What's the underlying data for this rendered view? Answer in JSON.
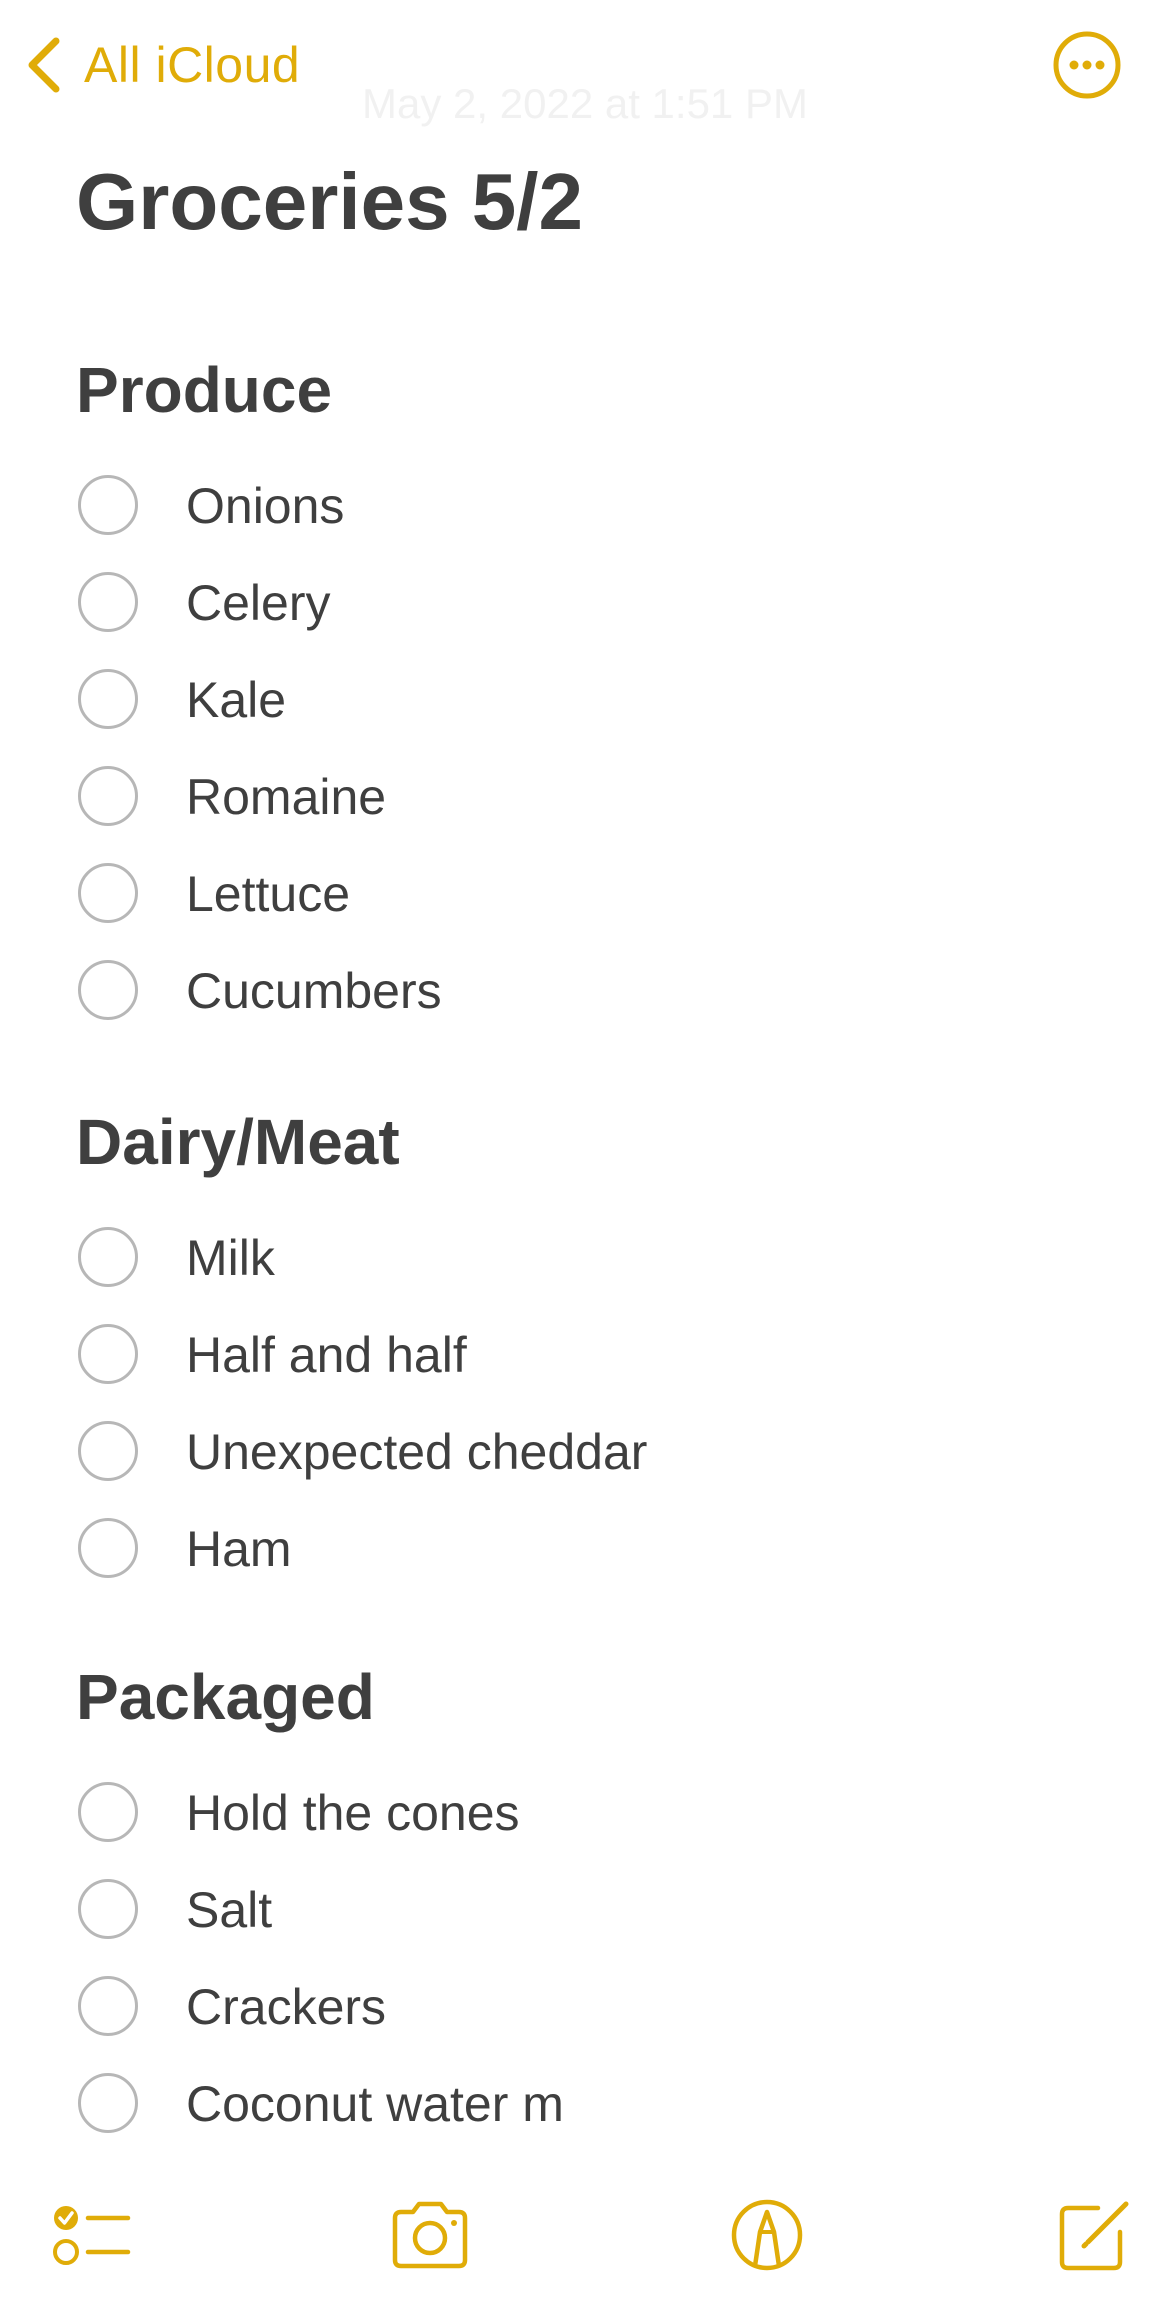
{
  "colors": {
    "accent": "#e0ac08",
    "text": "#3f3f3f",
    "checkbox_border": "#b7b7b7",
    "timestamp": "#f1f1f1"
  },
  "nav": {
    "back_label": "All iCloud",
    "back_icon": "chevron-left-icon",
    "timestamp": "May 2, 2022 at 1:51 PM",
    "more_icon": "ellipsis-circle-icon"
  },
  "note": {
    "title": "Groceries 5/2",
    "sections": [
      {
        "heading": "Produce",
        "items": [
          {
            "label": "Onions",
            "checked": false
          },
          {
            "label": "Celery",
            "checked": false
          },
          {
            "label": "Kale",
            "checked": false
          },
          {
            "label": "Romaine",
            "checked": false
          },
          {
            "label": "Lettuce",
            "checked": false
          },
          {
            "label": "Cucumbers",
            "checked": false
          }
        ]
      },
      {
        "heading": "Dairy/Meat",
        "items": [
          {
            "label": "Milk",
            "checked": false
          },
          {
            "label": "Half and half",
            "checked": false
          },
          {
            "label": "Unexpected cheddar",
            "checked": false
          },
          {
            "label": "Ham",
            "checked": false
          }
        ]
      },
      {
        "heading": "Packaged",
        "items": [
          {
            "label": "Hold the cones",
            "checked": false
          },
          {
            "label": "Salt",
            "checked": false
          },
          {
            "label": "Crackers",
            "checked": false
          },
          {
            "label": "Coconut water m",
            "checked": false
          }
        ]
      }
    ]
  },
  "toolbar": {
    "items": [
      {
        "icon": "checklist-icon"
      },
      {
        "icon": "camera-icon"
      },
      {
        "icon": "markup-pen-icon"
      },
      {
        "icon": "compose-icon"
      }
    ]
  }
}
